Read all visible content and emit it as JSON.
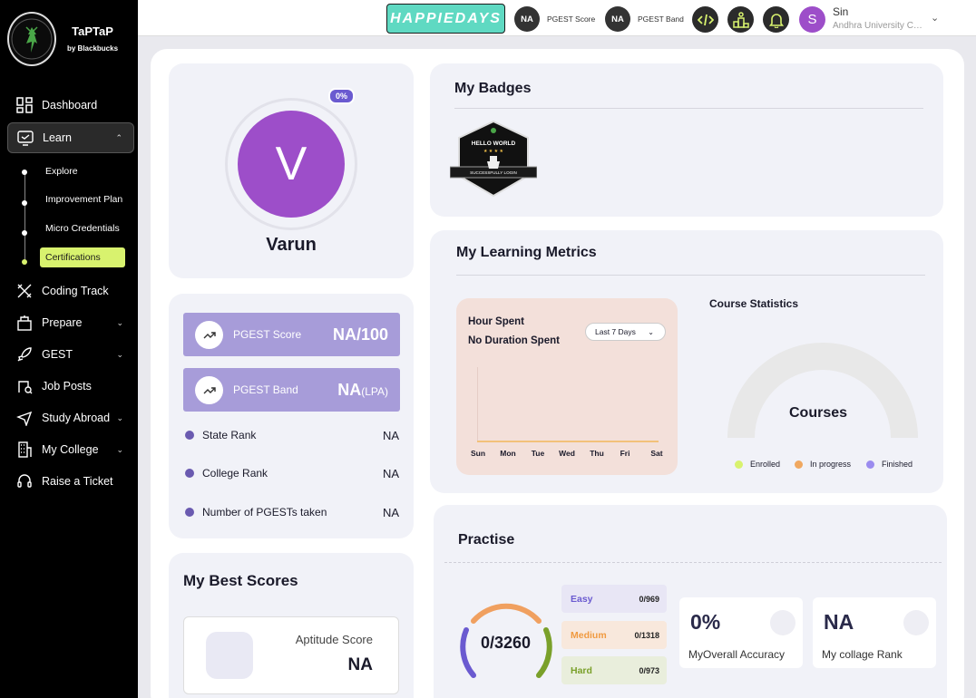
{
  "brand": {
    "name": "TaPTaP",
    "sub": "by Blackbucks",
    "logo_text": "TAPTAP"
  },
  "sidebar": {
    "items": [
      {
        "label": "Dashboard",
        "icon": "dashboard-icon"
      },
      {
        "label": "Learn",
        "icon": "learn-icon"
      },
      {
        "label": "Coding Track",
        "icon": "coding-icon"
      },
      {
        "label": "Prepare",
        "icon": "prepare-icon"
      },
      {
        "label": "GEST",
        "icon": "rocket-icon"
      },
      {
        "label": "Job Posts",
        "icon": "job-icon"
      },
      {
        "label": "Study Abroad",
        "icon": "plane-icon"
      },
      {
        "label": "My College",
        "icon": "building-icon"
      },
      {
        "label": "Raise a Ticket",
        "icon": "headset-icon"
      }
    ],
    "learn_sub": [
      "Explore",
      "Improvement Plan",
      "Micro Credentials",
      "Certifications"
    ]
  },
  "topbar": {
    "happiedays": "HAPPIEDAYS",
    "pgest_score_value": "NA",
    "pgest_score_label": "PGEST Score",
    "pgest_band_value": "NA",
    "pgest_band_label": "PGEST Band",
    "user_initial": "S",
    "user_name": "Sin",
    "user_college": "Andhra University College of Engineering"
  },
  "profile": {
    "initial": "V",
    "name": "Varun",
    "completion": "0%"
  },
  "scores": {
    "pgest_score_label": "PGEST Score",
    "pgest_score_value": "NA/100",
    "pgest_band_label": "PGEST Band",
    "pgest_band_value": "NA",
    "pgest_band_unit": "(LPA)"
  },
  "ranks": [
    {
      "label": "State Rank",
      "value": "NA"
    },
    {
      "label": "College Rank",
      "value": "NA"
    },
    {
      "label": "Number of PGESTs taken",
      "value": "NA"
    }
  ],
  "best_scores": {
    "title": "My Best Scores",
    "aptitude_label": "Aptitude Score",
    "aptitude_value": "NA"
  },
  "badges": {
    "title": "My Badges",
    "badge_top": "HELLO WORLD",
    "badge_bottom": "SUCCESSFULLY LOGIN"
  },
  "metrics": {
    "title": "My Learning Metrics",
    "hour_spent": "Hour Spent",
    "no_duration": "No Duration Spent",
    "range": "Last 7 Days",
    "days": [
      "Sun",
      "Mon",
      "Tue",
      "Wed",
      "Thu",
      "Fri",
      "Sat"
    ],
    "course_stats_title": "Course Statistics",
    "courses_label": "Courses",
    "legend": [
      {
        "label": "Enrolled",
        "color": "#d8f26e"
      },
      {
        "label": "In progress",
        "color": "#f0a860"
      },
      {
        "label": "Finished",
        "color": "#9b8cef"
      }
    ]
  },
  "practise": {
    "title": "Practise",
    "total": "0/3260",
    "difficulties": [
      {
        "label": "Easy",
        "value": "0/969",
        "color": "#6a5ad0",
        "bg": "#e8e6f5"
      },
      {
        "label": "Medium",
        "value": "0/1318",
        "color": "#f09a40",
        "bg": "#f8e8dc"
      },
      {
        "label": "Hard",
        "value": "0/973",
        "color": "#7aa02a",
        "bg": "#e9eedc"
      }
    ],
    "accuracy_value": "0%",
    "accuracy_label": "MyOverall Accuracy",
    "rank_value": "NA",
    "rank_label": "My collage Rank"
  }
}
